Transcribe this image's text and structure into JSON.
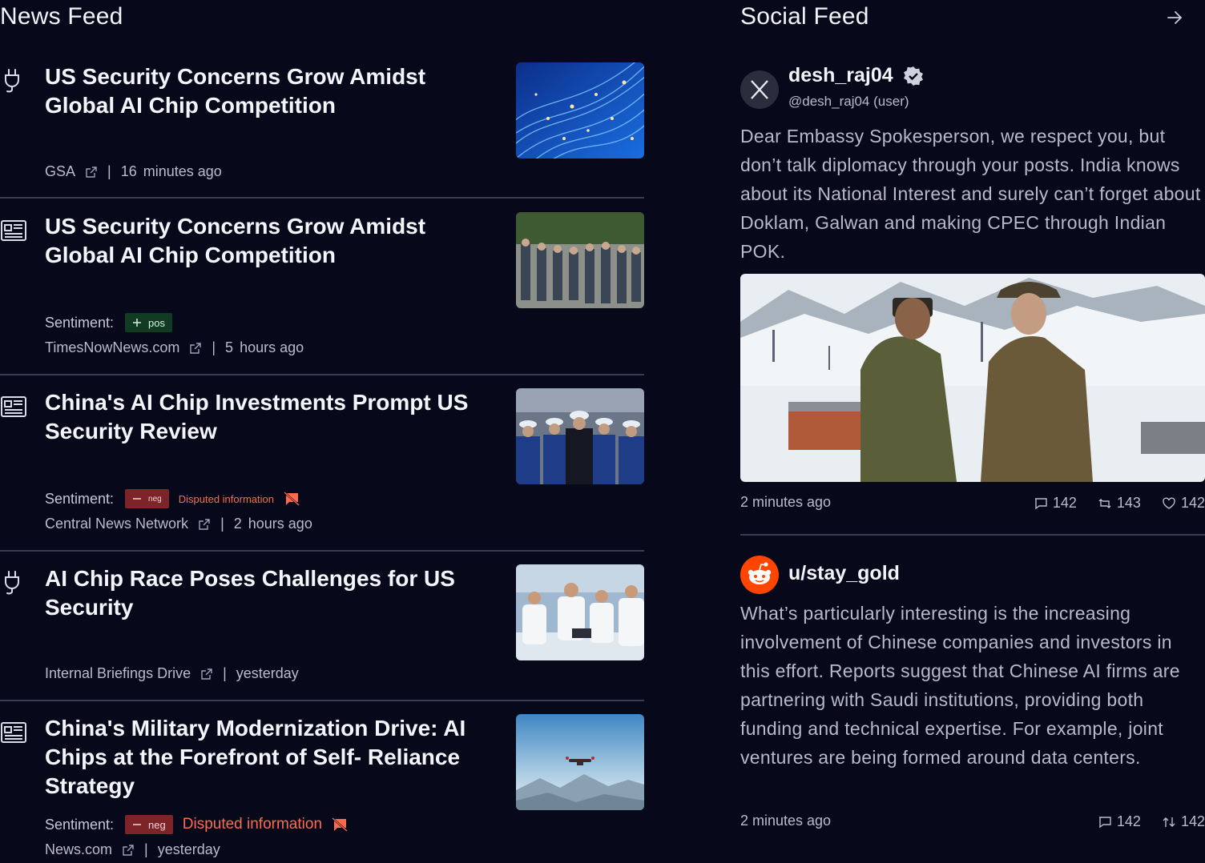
{
  "news": {
    "title": "News Feed",
    "items": [
      {
        "type_icon": "plug-icon",
        "headline": "US Security Concerns Grow Amidst Global AI Chip Competition",
        "image": "blue-fiber-optic-lights",
        "source": "GSA",
        "time_num": "16",
        "time_unit": "minutes ago"
      },
      {
        "type_icon": "newspaper-icon",
        "headline": "US Security Concerns Grow Amidst Global AI Chip Competition",
        "image": "soldiers-marching",
        "sentiment_label": "Sentiment:",
        "sentiment": "pos",
        "source": "TimesNowNews.com",
        "time_num": "5",
        "time_unit": "hours ago"
      },
      {
        "type_icon": "newspaper-icon",
        "headline": "China's AI Chip Investments Prompt US Security Review",
        "image": "naval-officers-parade",
        "sentiment_label": "Sentiment:",
        "sentiment": "neg",
        "flag": "Disputed information",
        "source": "Central News Network",
        "time_num": "2",
        "time_unit": "hours ago"
      },
      {
        "type_icon": "plug-icon",
        "headline": "AI Chip Race Poses Challenges for US Security",
        "image": "lab-researchers",
        "source": "Internal Briefings Drive",
        "time_unit": "yesterday"
      },
      {
        "type_icon": "newspaper-icon",
        "headline": "China's Military Modernization Drive: AI Chips at the Forefront of Self-  Reliance Strategy",
        "image": "drone-over-mountains",
        "sentiment_label": "Sentiment:",
        "sentiment": "neg",
        "flag": "Disputed information",
        "source": "News.com",
        "time_unit": "yesterday"
      }
    ]
  },
  "social": {
    "title": "Social Feed",
    "posts": [
      {
        "platform_icon": "x-logo-icon",
        "name": "desh_raj04",
        "verified": true,
        "handle": "@desh_raj04",
        "role": "(user)",
        "body": "Dear Embassy Spokesperson, we respect you, but don’t talk diplomacy through your posts. India knows about its National Interest and surely can’t forget about Doklam, Galwan and making CPEC through Indian POK.",
        "image": "soldiers-in-snow",
        "time": "2 minutes ago",
        "comments": "142",
        "reposts": "143",
        "likes": "142"
      },
      {
        "platform_icon": "reddit-logo-icon",
        "name": "u/stay_gold",
        "body": "What’s particularly interesting is the increasing involvement of Chinese companies and investors in this effort. Reports suggest that Chinese AI firms are partnering with Saudi institutions, providing both funding and technical expertise. For example, joint ventures are being formed around data centers.",
        "time": "2 minutes ago",
        "comments": "142",
        "votes": "142"
      }
    ]
  },
  "colors": {
    "background": "#07081a",
    "positive_badge": "#113b22",
    "negative_badge": "#7c2428",
    "disputed_text": "#ff6a4d",
    "reddit_orange": "#ff4500"
  }
}
